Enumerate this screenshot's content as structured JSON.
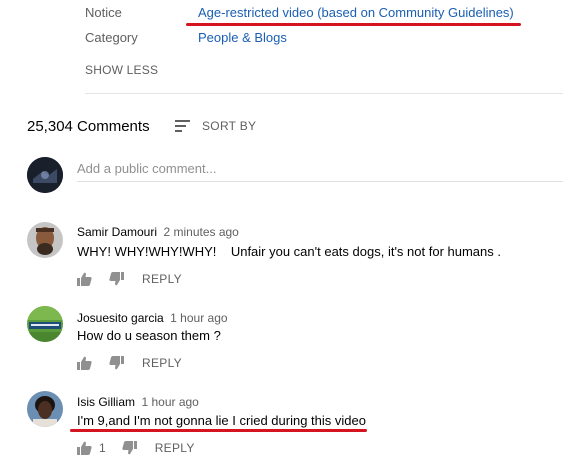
{
  "details": {
    "notice_label": "Notice",
    "notice_value": "Age-restricted video (based on Community Guidelines)",
    "category_label": "Category",
    "category_value": "People & Blogs",
    "show_less": "SHOW LESS"
  },
  "comments_header": {
    "count": "25,304 Comments",
    "sort_label": "SORT BY",
    "add_placeholder": "Add a public comment..."
  },
  "comments": [
    {
      "author": "Samir Damouri",
      "time": "2 minutes ago",
      "text": "WHY! WHY!WHY!WHY!    Unfair you can't eats dogs, it's not for humans .",
      "likes": "",
      "reply": "REPLY"
    },
    {
      "author": "Josuesito garcia",
      "time": "1 hour ago",
      "text": "How do u season them ?",
      "likes": "",
      "reply": "REPLY"
    },
    {
      "author": "Isis Gilliam",
      "time": "1 hour ago",
      "text": "I'm 9,and I'm not gonna lie I cried during this video",
      "likes": "1",
      "reply": "REPLY"
    }
  ],
  "colors": {
    "link": "#1a5fb4",
    "annotation_underline": "#d4141f"
  },
  "icons": [
    "sort-icon",
    "thumbs-up-icon",
    "thumbs-down-icon"
  ]
}
